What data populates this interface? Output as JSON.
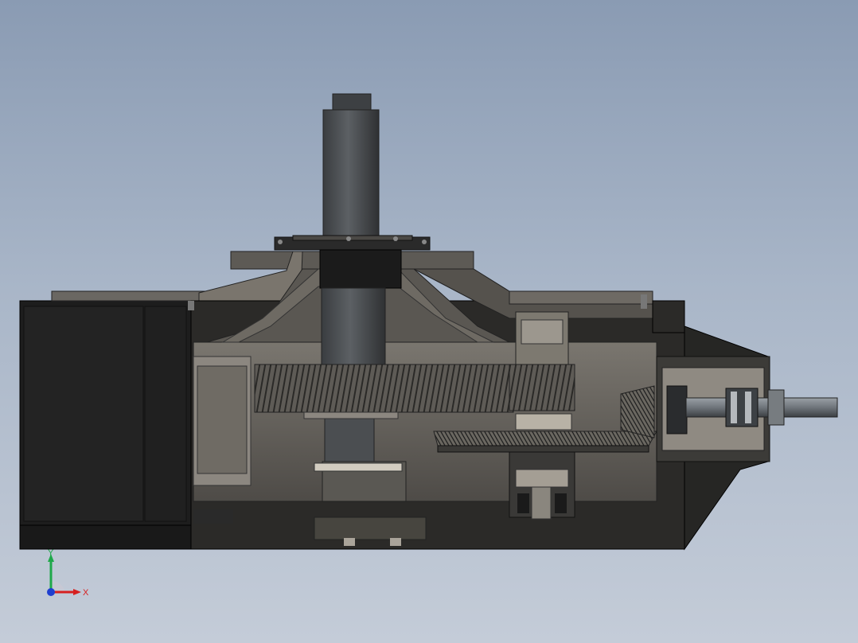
{
  "viewport": {
    "background_top": "#8a9bb3",
    "background_bottom": "#c4ccd8"
  },
  "model": {
    "icon": "gearbox-section-view",
    "colors": {
      "housing_dark": "#1e1e1e",
      "housing_mid": "#3a3937",
      "section_fill": "#6b6863",
      "section_light": "#8c8780",
      "shaft": "#4a4d50",
      "gear": "#55524d",
      "highlight": "#b8b2a6"
    }
  },
  "triad": {
    "x_label": "X",
    "y_label": "Y",
    "x_color": "#d62020",
    "y_color": "#1fa84a",
    "z_color": "#1f3fd0"
  }
}
